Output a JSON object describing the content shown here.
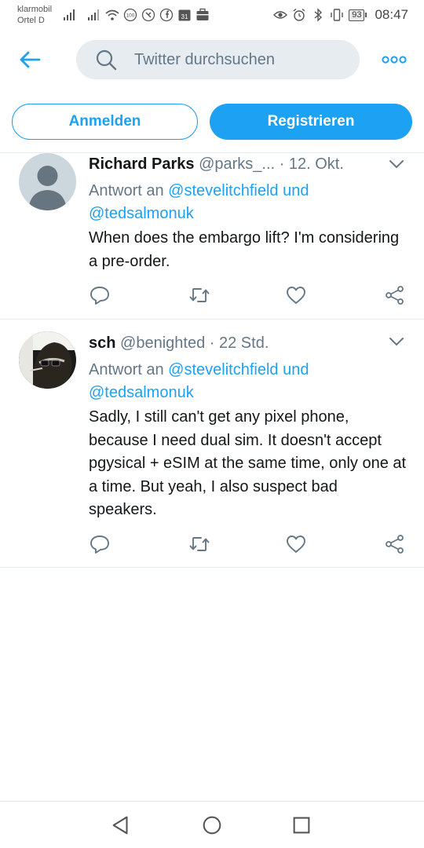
{
  "status_bar": {
    "carrier_line1": "klarmobil",
    "carrier_line2": "Ortel D",
    "notification_badge": "100",
    "calendar_day": "31",
    "battery": "93",
    "time": "08:47"
  },
  "header": {
    "search_placeholder": "Twitter durchsuchen"
  },
  "auth": {
    "login_label": "Anmelden",
    "register_label": "Registrieren"
  },
  "tweets": [
    {
      "name": "Richard Parks",
      "handle": "@parks_...",
      "separator": "·",
      "time": "12. Okt.",
      "reply_prefix": "Antwort an",
      "reply_to_1": "@stevelitchfield",
      "reply_and": "und",
      "reply_to_2": "@tedsalmonuk",
      "text": "When does the embargo lift? I'm considering a pre-order."
    },
    {
      "name": "sch",
      "handle": "@benighted",
      "separator": "·",
      "time": "22 Std.",
      "reply_prefix": "Antwort an",
      "reply_to_1": "@stevelitchfield",
      "reply_and": "und",
      "reply_to_2": "@tedsalmonuk",
      "text": "Sadly, I still can't get any pixel phone, because I need dual sim. It doesn't accept pgysical + eSIM at the same time, only one at a time. But yeah, I also suspect bad speakers."
    }
  ],
  "colors": {
    "accent": "#1da1f2",
    "secondary_text": "#657786",
    "primary_text": "#14171a",
    "divider": "#e6ecf0"
  },
  "icons": {
    "back": "arrow-left-icon",
    "search": "search-icon",
    "more": "more-dots-icon",
    "reply": "comment-icon",
    "retweet": "retweet-icon",
    "like": "heart-icon",
    "share": "share-icon",
    "caret": "chevron-down-icon"
  }
}
